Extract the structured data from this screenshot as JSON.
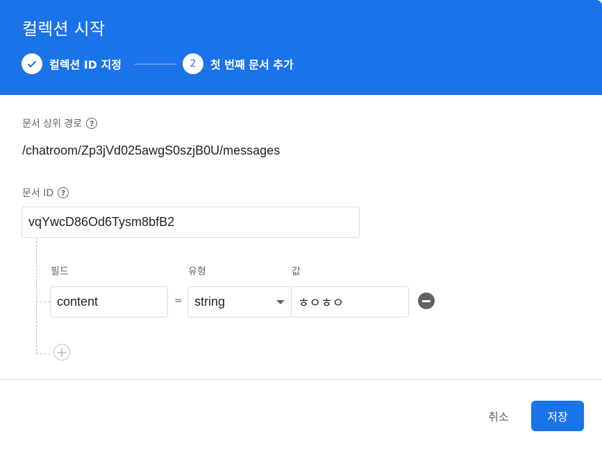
{
  "header": {
    "title": "컬렉션 시작",
    "steps": [
      {
        "label": "컬렉션 ID 지정",
        "status": "complete"
      },
      {
        "number": "2",
        "label": "첫 번째 문서 추가",
        "status": "active"
      }
    ]
  },
  "form": {
    "parent_path_label": "문서 상위 경로",
    "parent_path_value": "/chatroom/Zp3jVd025awgS0szjB0U/messages",
    "doc_id_label": "문서 ID",
    "doc_id_value": "vqYwcD86Od6Tysm8bfB2"
  },
  "fields": {
    "col_field": "필드",
    "col_type": "유형",
    "col_value": "값",
    "rows": [
      {
        "field": "content",
        "equals": "=",
        "type": "string",
        "value": "ㅎㅇㅎㅇ"
      }
    ]
  },
  "footer": {
    "cancel_label": "취소",
    "save_label": "저장"
  },
  "colors": {
    "header_bg": "#1a73e8",
    "primary": "#1a73e8"
  }
}
